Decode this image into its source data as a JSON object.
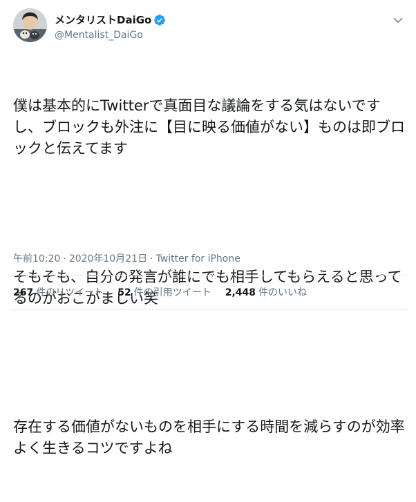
{
  "colors": {
    "text_primary": "#14171a",
    "text_secondary": "#657786",
    "verified_blue": "#1da1f2",
    "divider": "#e6ecf0"
  },
  "author": {
    "display_name": "メンタリストDaiGo",
    "handle": "@Mentalist_DaiGo",
    "verified": true,
    "avatar_icon": "profile-photo"
  },
  "tweet": {
    "paragraphs": [
      "僕は基本的にTwitterで真面目な議論をする気はないですし、ブロックも外注に【目に映る価値がない】ものは即ブロックと伝えてます",
      "そもそも、自分の発言が誰にでも相手してもらえると思ってるのがおこがましい笑",
      "存在する価値がないものを相手にする時間を減らすのが効率よく生きるコツですよね"
    ],
    "time": "午前10:20",
    "separator": "·",
    "date": "2020年10月21日",
    "source": "Twitter for iPhone"
  },
  "stats": {
    "retweets_count": "267",
    "retweets_label": "件のリツイート",
    "quotes_count": "52",
    "quotes_label": "件の引用ツイート",
    "likes_count": "2,448",
    "likes_label": "件のいいね"
  }
}
